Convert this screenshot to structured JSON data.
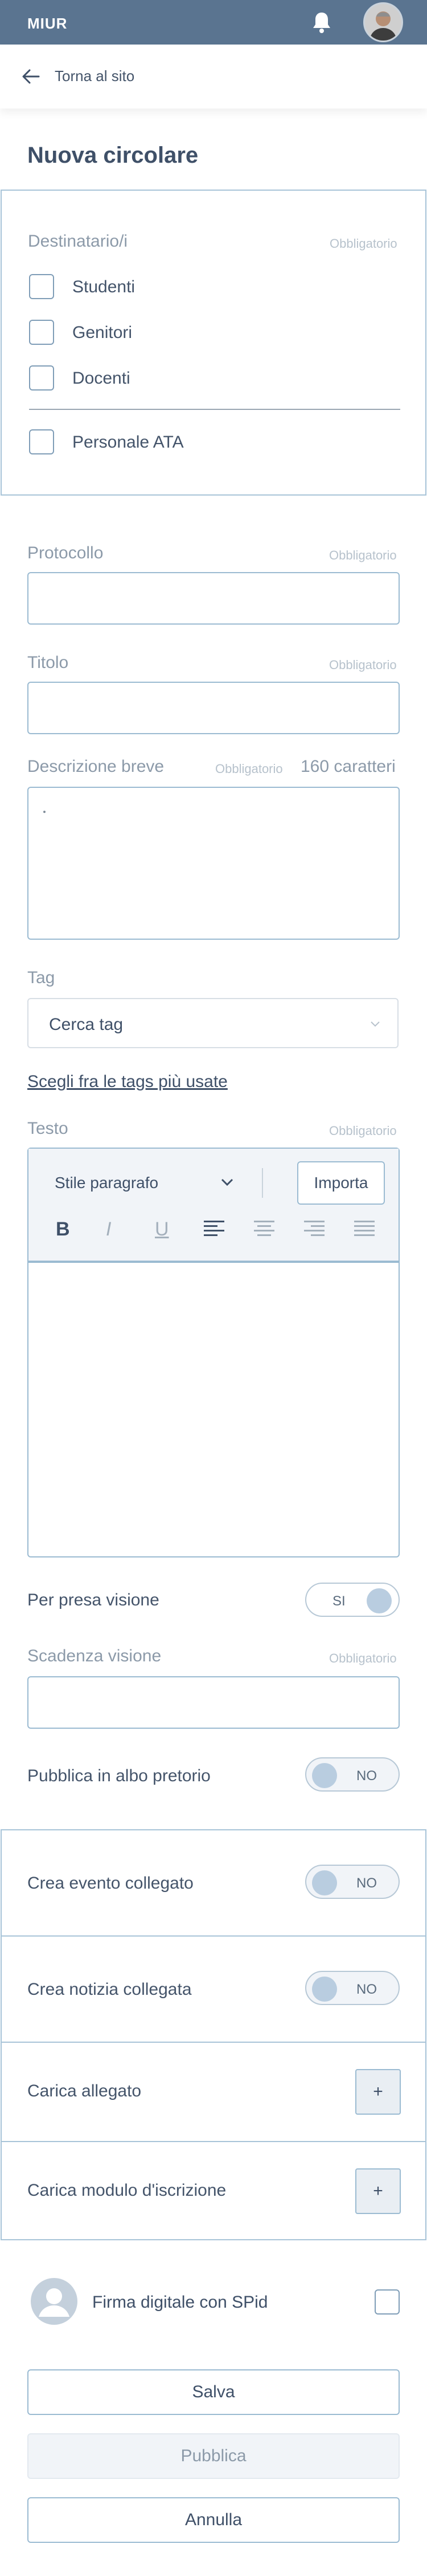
{
  "header": {
    "brand": "MIUR",
    "icons": [
      "bell-icon",
      "avatar"
    ],
    "colors": {
      "bar": "#5a7490",
      "text": "#ffffff"
    }
  },
  "nav": {
    "back_label": "Torna al sito",
    "back_icon": "arrow-left-icon"
  },
  "page": {
    "title": "Nuova circolare"
  },
  "recipients": {
    "label": "Destinatario/i",
    "required": "Obbligatorio",
    "options": [
      "Studenti",
      "Genitori",
      "Docenti",
      "Personale ATA"
    ]
  },
  "protocol": {
    "label": "Protocollo",
    "required": "Obbligatorio",
    "value": ""
  },
  "title_field": {
    "label": "Titolo",
    "required": "Obbligatorio",
    "value": ""
  },
  "description": {
    "label": "Descrizione breve",
    "required": "Obbligatorio",
    "counter": "160 caratteri",
    "value": ""
  },
  "tag": {
    "label": "Tag",
    "selected": "Cerca tag",
    "link": "Scegli fra le tags più usate"
  },
  "text": {
    "label": "Testo",
    "required": "Obbligatorio",
    "paragraph_style": "Stile paragrafo",
    "import_label": "Importa",
    "format_buttons": [
      "bold-icon",
      "italic-icon",
      "underline-icon",
      "align-left-icon",
      "align-center-icon",
      "align-right-icon",
      "align-justify-icon"
    ],
    "bold": "B",
    "italic": "I",
    "underline": "U"
  },
  "presa_visione": {
    "label": "Per presa visione",
    "toggle": "SI"
  },
  "scadenza": {
    "label": "Scadenza visione",
    "required": "Obbligatorio",
    "value": ""
  },
  "albo": {
    "label": "Pubblica in albo pretorio",
    "toggle": "NO"
  },
  "evento": {
    "label": "Crea evento collegato",
    "toggle": "NO"
  },
  "notizia": {
    "label": "Crea notizia collegata",
    "toggle": "NO"
  },
  "allegato": {
    "label": "Carica allegato",
    "button": "+"
  },
  "modulo": {
    "label": "Carica modulo d'iscrizione",
    "button": "+"
  },
  "signature": {
    "label": "Firma digitale con SPid",
    "icon": "user-avatar-icon"
  },
  "actions": {
    "save": "Salva",
    "publish": "Pubblica",
    "cancel": "Annulla"
  }
}
